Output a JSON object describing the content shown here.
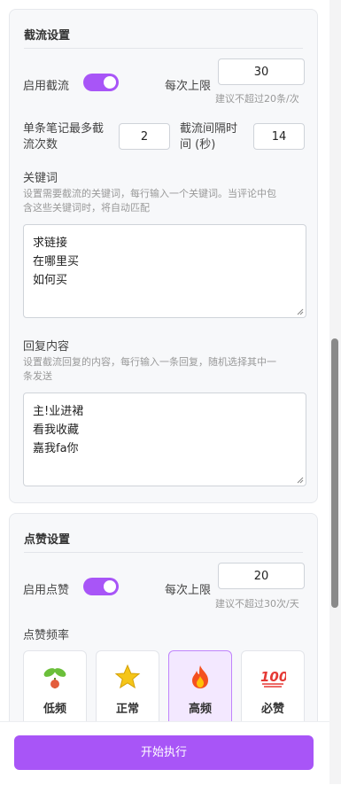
{
  "throttle": {
    "title": "截流设置",
    "enable_label": "启用截流",
    "enabled": true,
    "per_limit_label": "每次上限",
    "per_limit_value": "30",
    "per_limit_hint": "建议不超过20条/次",
    "max_per_note_label_line1": "单条笔记最多截",
    "max_per_note_label_line2": "流次数",
    "max_per_note_value": "2",
    "interval_label_line1": "截流间隔时",
    "interval_label_line2": "间 (秒)",
    "interval_value": "14",
    "keywords_label": "关键词",
    "keywords_hint_line1": "设置需要截流的关键词，每行输入一个关键词。当评论中包",
    "keywords_hint_line2": "含这些关键词时，将自动匹配",
    "keywords": [
      "求链接",
      "在哪里买",
      "如何买"
    ],
    "reply_label": "回复内容",
    "reply_hint_line1": "设置截流回复的内容，每行输入一条回复，随机选择其中一",
    "reply_hint_line2": "条发送",
    "replies": [
      "主!业进裙",
      "看我收藏",
      "嘉我fa你"
    ]
  },
  "like": {
    "title": "点赞设置",
    "enable_label": "启用点赞",
    "enabled": true,
    "per_limit_label": "每次上限",
    "per_limit_value": "20",
    "per_limit_hint": "建议不超过30次/天",
    "frequency_label": "点赞频率",
    "frequency_options": [
      {
        "name": "低频",
        "icon": "seedling-icon",
        "selected": false
      },
      {
        "name": "正常",
        "icon": "star-icon",
        "selected": false
      },
      {
        "name": "高频",
        "icon": "fire-icon",
        "selected": true
      },
      {
        "name": "必赞",
        "icon": "hundred-icon",
        "selected": false
      }
    ]
  },
  "footer": {
    "start_label": "开始执行"
  },
  "colors": {
    "accent": "#a855f7",
    "accent_light": "#f3e8ff"
  }
}
